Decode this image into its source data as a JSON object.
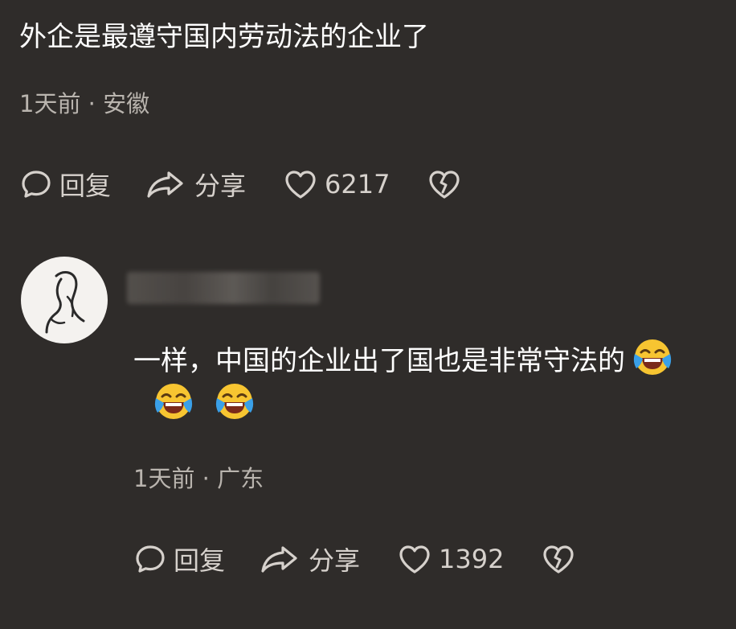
{
  "comments": [
    {
      "text": "外企是最遵守国内劳动法的企业了",
      "meta": "1天前 · 安徽",
      "actions": {
        "reply": "回复",
        "share": "分享",
        "likes": "6217"
      }
    },
    {
      "text": "一样，中国的企业出了国也是非常守法的",
      "meta": "1天前 · 广东",
      "emoji_count": 3,
      "emoji_icon": "laughing-crying-face",
      "actions": {
        "reply": "回复",
        "share": "分享",
        "likes": "1392"
      }
    }
  ]
}
